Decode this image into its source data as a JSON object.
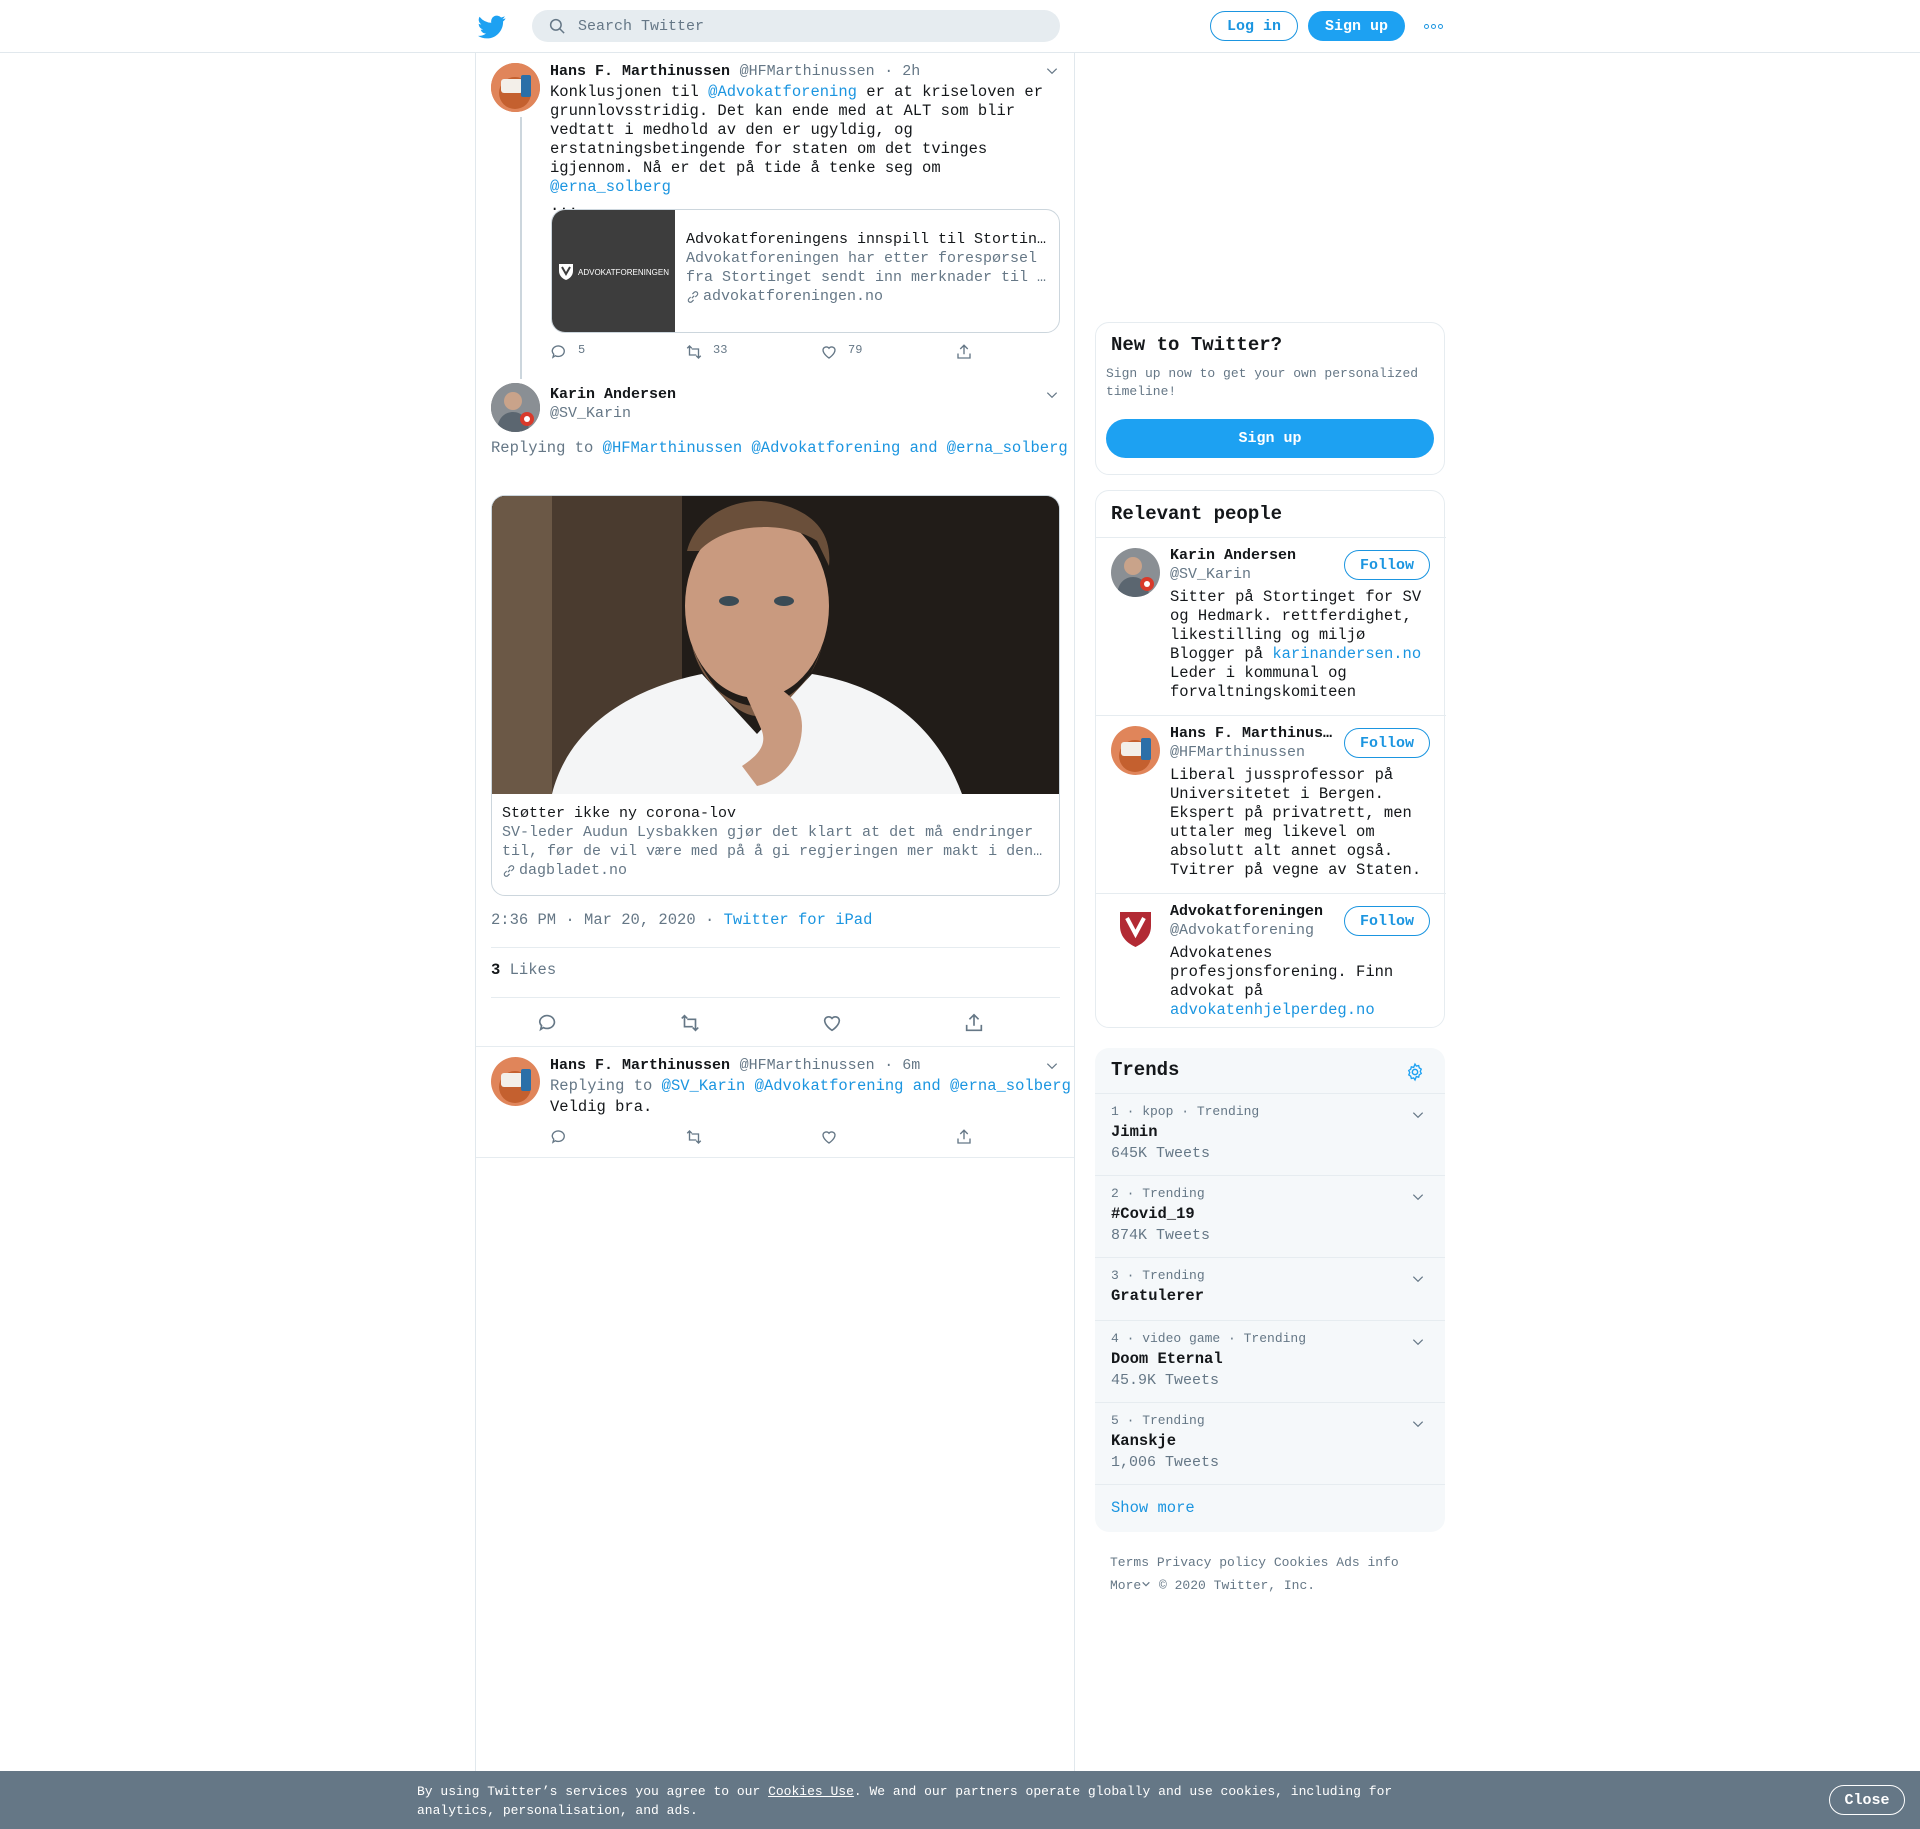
{
  "header": {
    "search_placeholder": "Search Twitter",
    "login_label": "Log in",
    "signup_label": "Sign up"
  },
  "tweet1": {
    "name": "Hans F. Marthinussen",
    "handle": "@HFMarthinussen",
    "time": "· 2h",
    "text_part1": "Konklusjonen til ",
    "mention1": "@Advokatforening",
    "text_part2": " er at kriseloven er grunnlovsstridig. Det kan ende med at ALT som blir vedtatt i medhold av den er ugyldig, og erstatningsbetingende for staten om det tvinges igjennom. Nå er det på tide å tenke seg om ",
    "mention2": "@erna_solberg",
    "text_part3": " ...",
    "card": {
      "title": "Advokatforeningens innspill til Stortin…",
      "desc": "Advokatforeningen har etter forespørsel fra Stortinget sendt inn merknader til …",
      "domain": "advokatforeningen.no",
      "logo_text": "ADVOKATFORENINGEN"
    },
    "replies": "5",
    "retweets": "33",
    "likes": "79"
  },
  "tweet2": {
    "name": "Karin Andersen",
    "handle": "@SV_Karin",
    "replying_label": "Replying to",
    "replying_to": "@HFMarthinussen @Advokatforening and @erna_solberg",
    "card": {
      "title": "Støtter ikke ny corona-lov",
      "desc": "SV-leder Audun Lysbakken gjør det klart at det må endringer til, før de vil være med på å gi regjeringen mer makt i den…",
      "domain": "dagbladet.no"
    },
    "timestamp": "2:36 PM · Mar 20, 2020",
    "source_sep": "·",
    "source": "Twitter for iPad",
    "likes_count": "3",
    "likes_label": "Likes"
  },
  "tweet3": {
    "name": "Hans F. Marthinussen",
    "handle": "@HFMarthinussen",
    "time": "· 6m",
    "replying_label": "Replying to",
    "replying_to": "@SV_Karin @Advokatforening and @erna_solberg",
    "text": "Veldig bra."
  },
  "new_to_twitter": {
    "title": "New to Twitter?",
    "subtitle": "Sign up now to get your own personalized timeline!",
    "button": "Sign up"
  },
  "relevant": {
    "title": "Relevant people",
    "follow_label": "Follow",
    "people": [
      {
        "name": "Karin Andersen",
        "handle": "@SV_Karin",
        "bio": "Sitter på Stortinget for SV og Hedmark. rettferdighet, likestilling og miljø Blogger på ",
        "link": "karinandersen.no",
        "bio2": "Leder i kommunal og forvaltningskomiteen"
      },
      {
        "name": "Hans F. Marthinus…",
        "handle": "@HFMarthinussen",
        "bio": "Liberal jussprofessor på Universitetet i Bergen. Ekspert på privatrett, men uttaler meg likevel om absolutt alt annet også. Tvitrer på vegne av Staten.",
        "link": "",
        "bio2": ""
      },
      {
        "name": "Advokatforeningen",
        "handle": "@Advokatforening",
        "bio": "Advokatenes profesjonsforening. Finn advokat på ",
        "link": "advokatenhjelperdeg.no",
        "bio2": ""
      }
    ]
  },
  "trends": {
    "title": "Trends",
    "items": [
      {
        "meta": "1 · kpop · Trending",
        "name": "Jimin",
        "count": "645K Tweets"
      },
      {
        "meta": "2 · Trending",
        "name": "#Covid_19",
        "count": "874K Tweets"
      },
      {
        "meta": "3 · Trending",
        "name": "Gratulerer",
        "count": ""
      },
      {
        "meta": "4 · video game · Trending",
        "name": "Doom Eternal",
        "count": "45.9K Tweets"
      },
      {
        "meta": "5 · Trending",
        "name": "Kanskje",
        "count": "1,006 Tweets"
      }
    ],
    "show_more": "Show more"
  },
  "footer": {
    "terms": "Terms",
    "privacy": "Privacy policy",
    "cookies": "Cookies",
    "ads": "Ads info",
    "more": "More",
    "copyright": "© 2020 Twitter, Inc."
  },
  "cookie_bar": {
    "text1": "By using Twitter’s services you agree to our ",
    "link": "Cookies Use",
    "text2": ". We and our partners operate globally and use cookies, including for analytics, personalisation, and ads.",
    "close": "Close"
  },
  "colors": {
    "accent": "#1da1f2",
    "link": "#1b95e0",
    "secondary": "#657786",
    "cookie_bar": "#657786"
  }
}
